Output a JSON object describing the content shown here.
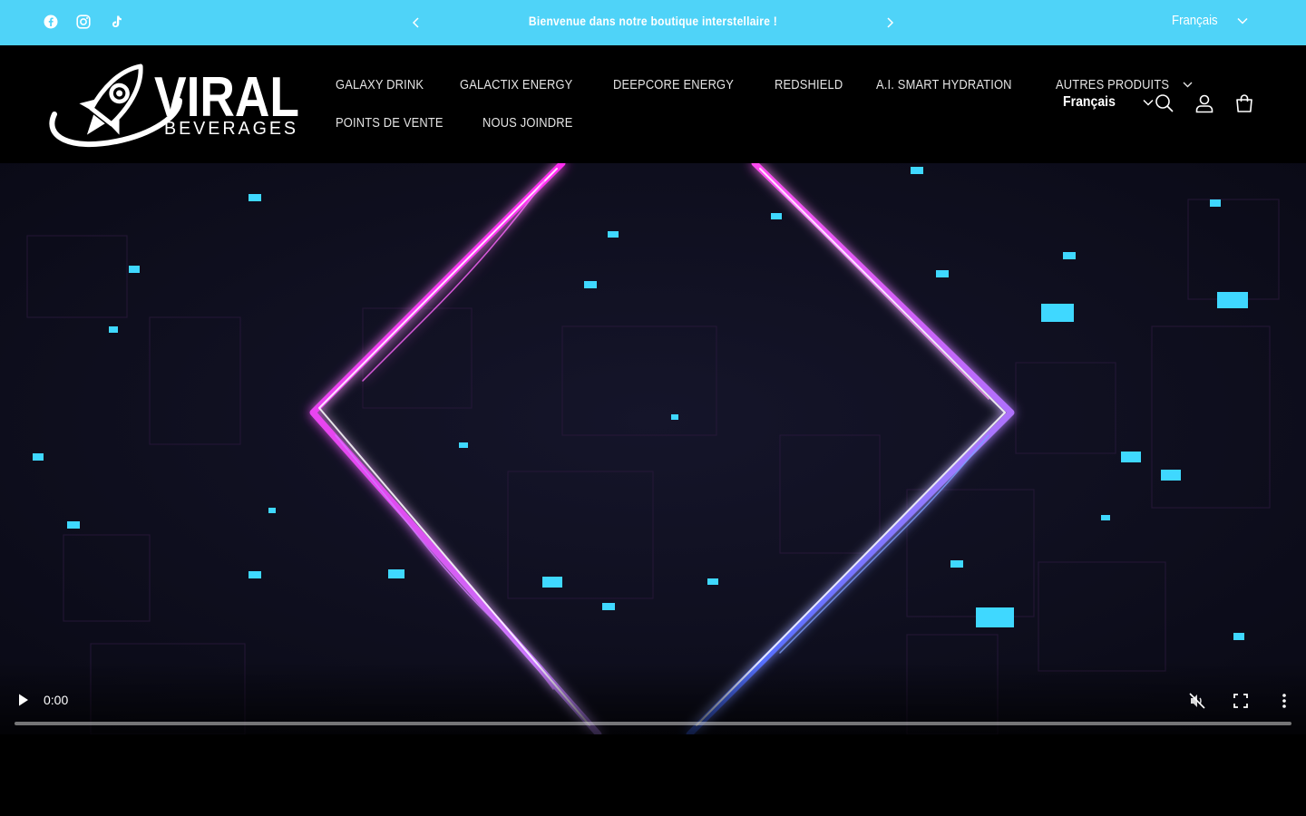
{
  "announcement": {
    "message": "Bienvenue dans notre boutique interstellaire !",
    "language": "Français",
    "social": [
      "facebook-icon",
      "instagram-icon",
      "tiktok-icon"
    ],
    "background": "#4fd3f8"
  },
  "header": {
    "logo": {
      "word": "VIRAL",
      "sub": "BEVERAGES"
    },
    "nav": [
      {
        "label": "GALAXY DRINK"
      },
      {
        "label": "GALACTIX ENERGY"
      },
      {
        "label": "DEEPCORE ENERGY"
      },
      {
        "label": "REDSHIELD"
      },
      {
        "label": "A.I. SMART HYDRATION"
      },
      {
        "label": "AUTRES PRODUITS"
      },
      {
        "label": "POINTS DE VENTE"
      },
      {
        "label": "NOUS JOINDRE"
      }
    ],
    "language": "Français",
    "icons": [
      "search-icon",
      "account-icon",
      "cart-icon"
    ]
  },
  "video": {
    "time": "0:00",
    "progress": 0,
    "accent_colors": [
      "#ff3df5",
      "#5a8cff",
      "#3fd8ff"
    ]
  }
}
